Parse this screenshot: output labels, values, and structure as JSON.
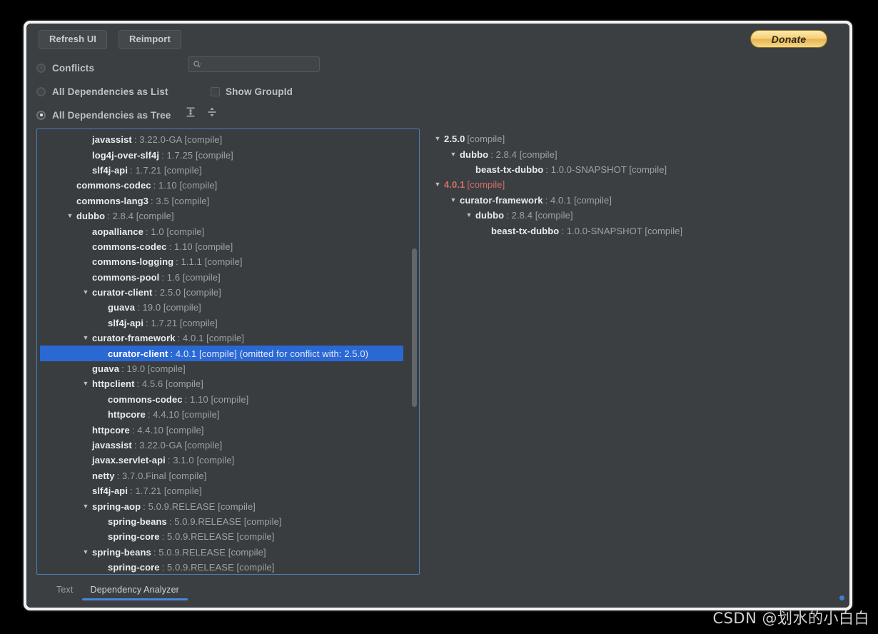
{
  "toolbar": {
    "refresh_label": "Refresh UI",
    "reimport_label": "Reimport",
    "donate_label": "Donate",
    "search_placeholder": "",
    "search_value": "",
    "search_icon": "search-icon",
    "expand_all_icon": "expand-all-icon",
    "collapse_all_icon": "collapse-all-icon"
  },
  "options": {
    "conflicts_label": "Conflicts",
    "all_as_list_label": "All Dependencies as List",
    "all_as_tree_label": "All Dependencies as Tree",
    "show_groupid_label": "Show GroupId",
    "selected": "All Dependencies as Tree",
    "show_groupid_checked": false
  },
  "colors": {
    "accent_blue": "#2a68d4",
    "focus_border": "#4a7ebb",
    "conflict_red": "#d1706a",
    "panel_bg": "#3c3f41",
    "donate_gold": "#f6cf74"
  },
  "left_tree": {
    "nodes": [
      {
        "depth": 2,
        "twisty": "",
        "name": "javassist",
        "meta": ": 3.22.0-GA [compile]"
      },
      {
        "depth": 2,
        "twisty": "",
        "name": "log4j-over-slf4j",
        "meta": ": 1.7.25 [compile]"
      },
      {
        "depth": 2,
        "twisty": "",
        "name": "slf4j-api",
        "meta": ": 1.7.21 [compile]"
      },
      {
        "depth": 1,
        "twisty": "",
        "name": "commons-codec",
        "meta": ": 1.10 [compile]"
      },
      {
        "depth": 1,
        "twisty": "",
        "name": "commons-lang3",
        "meta": ": 3.5 [compile]"
      },
      {
        "depth": 1,
        "twisty": "▼",
        "name": "dubbo",
        "meta": ": 2.8.4 [compile]"
      },
      {
        "depth": 2,
        "twisty": "",
        "name": "aopalliance",
        "meta": ": 1.0 [compile]"
      },
      {
        "depth": 2,
        "twisty": "",
        "name": "commons-codec",
        "meta": ": 1.10 [compile]"
      },
      {
        "depth": 2,
        "twisty": "",
        "name": "commons-logging",
        "meta": ": 1.1.1 [compile]"
      },
      {
        "depth": 2,
        "twisty": "",
        "name": "commons-pool",
        "meta": ": 1.6 [compile]"
      },
      {
        "depth": 2,
        "twisty": "▼",
        "name": "curator-client",
        "meta": ": 2.5.0 [compile]"
      },
      {
        "depth": 3,
        "twisty": "",
        "name": "guava",
        "meta": ": 19.0 [compile]"
      },
      {
        "depth": 3,
        "twisty": "",
        "name": "slf4j-api",
        "meta": ": 1.7.21 [compile]"
      },
      {
        "depth": 2,
        "twisty": "▼",
        "name": "curator-framework",
        "meta": ": 4.0.1 [compile]"
      },
      {
        "depth": 3,
        "twisty": "",
        "name": "curator-client",
        "meta": ": 4.0.1 [compile] (omitted for conflict with: 2.5.0)",
        "selected": true
      },
      {
        "depth": 2,
        "twisty": "",
        "name": "guava",
        "meta": ": 19.0 [compile]"
      },
      {
        "depth": 2,
        "twisty": "▼",
        "name": "httpclient",
        "meta": ": 4.5.6 [compile]"
      },
      {
        "depth": 3,
        "twisty": "",
        "name": "commons-codec",
        "meta": ": 1.10 [compile]"
      },
      {
        "depth": 3,
        "twisty": "",
        "name": "httpcore",
        "meta": ": 4.4.10 [compile]"
      },
      {
        "depth": 2,
        "twisty": "",
        "name": "httpcore",
        "meta": ": 4.4.10 [compile]"
      },
      {
        "depth": 2,
        "twisty": "",
        "name": "javassist",
        "meta": ": 3.22.0-GA [compile]"
      },
      {
        "depth": 2,
        "twisty": "",
        "name": "javax.servlet-api",
        "meta": ": 3.1.0 [compile]"
      },
      {
        "depth": 2,
        "twisty": "",
        "name": "netty",
        "meta": ": 3.7.0.Final [compile]"
      },
      {
        "depth": 2,
        "twisty": "",
        "name": "slf4j-api",
        "meta": ": 1.7.21 [compile]"
      },
      {
        "depth": 2,
        "twisty": "▼",
        "name": "spring-aop",
        "meta": ": 5.0.9.RELEASE [compile]"
      },
      {
        "depth": 3,
        "twisty": "",
        "name": "spring-beans",
        "meta": ": 5.0.9.RELEASE [compile]"
      },
      {
        "depth": 3,
        "twisty": "",
        "name": "spring-core",
        "meta": ": 5.0.9.RELEASE [compile]"
      },
      {
        "depth": 2,
        "twisty": "▼",
        "name": "spring-beans",
        "meta": ": 5.0.9.RELEASE [compile]"
      },
      {
        "depth": 3,
        "twisty": "",
        "name": "spring-core",
        "meta": ": 5.0.9.RELEASE [compile]"
      }
    ]
  },
  "right_tree": {
    "nodes": [
      {
        "depth": 0,
        "twisty": "▼",
        "name": "2.5.0",
        "meta": "[compile]",
        "nocolon": true
      },
      {
        "depth": 1,
        "twisty": "▼",
        "name": "dubbo",
        "meta": ": 2.8.4 [compile]"
      },
      {
        "depth": 2,
        "twisty": "",
        "name": "beast-tx-dubbo",
        "meta": ": 1.0.0-SNAPSHOT [compile]"
      },
      {
        "depth": 0,
        "twisty": "▼",
        "name": "4.0.1",
        "meta": "[compile]",
        "nocolon": true,
        "conflict": true
      },
      {
        "depth": 1,
        "twisty": "▼",
        "name": "curator-framework",
        "meta": ": 4.0.1 [compile]"
      },
      {
        "depth": 2,
        "twisty": "▼",
        "name": "dubbo",
        "meta": ": 2.8.4 [compile]"
      },
      {
        "depth": 3,
        "twisty": "",
        "name": "beast-tx-dubbo",
        "meta": ": 1.0.0-SNAPSHOT [compile]"
      }
    ]
  },
  "bottom_tabs": {
    "tabs": [
      {
        "label": "Text",
        "active": false
      },
      {
        "label": "Dependency Analyzer",
        "active": true
      }
    ]
  },
  "watermark": {
    "text": "CSDN @划水的小白白"
  }
}
